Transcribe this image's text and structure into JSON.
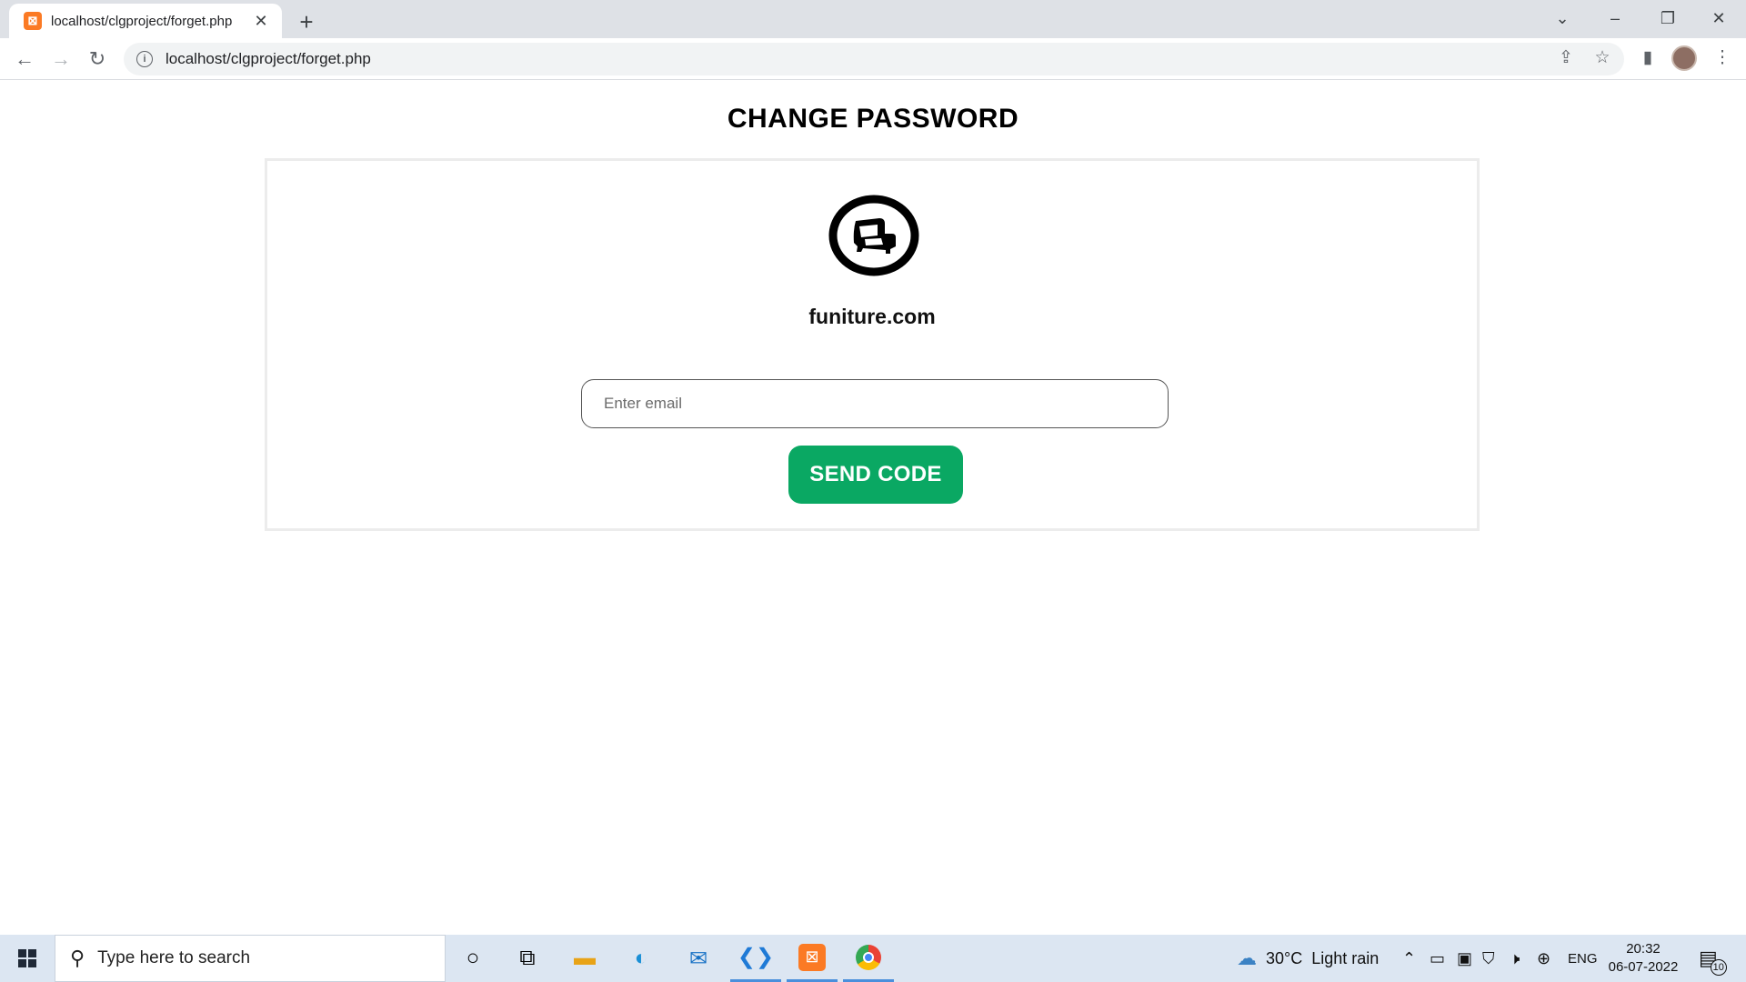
{
  "browser": {
    "tab": {
      "title": "localhost/clgproject/forget.php",
      "favicon": "xampp-icon"
    },
    "url": "localhost/clgproject/forget.php"
  },
  "page": {
    "title": "CHANGE PASSWORD",
    "brand": "funiture.com",
    "email_placeholder": "Enter email",
    "send_button": "SEND CODE",
    "accent_color": "#0aa863"
  },
  "taskbar": {
    "search_placeholder": "Type here to search",
    "weather": "30°C  Light rain",
    "language": "ENG",
    "time": "20:32",
    "date": "06-07-2022",
    "notifications": "10"
  }
}
